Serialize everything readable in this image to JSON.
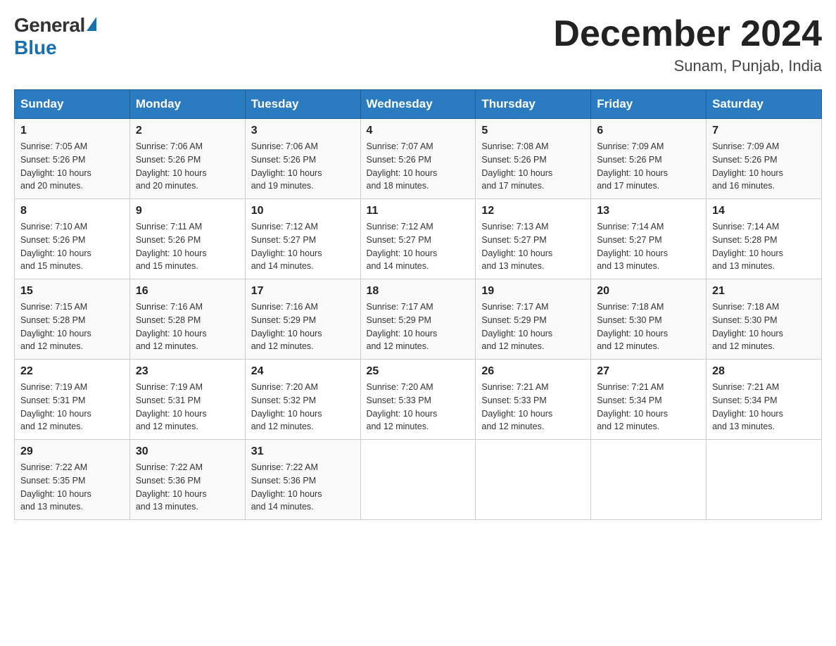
{
  "logo": {
    "general": "General",
    "blue": "Blue"
  },
  "title": "December 2024",
  "location": "Sunam, Punjab, India",
  "days_of_week": [
    "Sunday",
    "Monday",
    "Tuesday",
    "Wednesday",
    "Thursday",
    "Friday",
    "Saturday"
  ],
  "weeks": [
    [
      {
        "day": "1",
        "sunrise": "7:05 AM",
        "sunset": "5:26 PM",
        "daylight": "10 hours and 20 minutes."
      },
      {
        "day": "2",
        "sunrise": "7:06 AM",
        "sunset": "5:26 PM",
        "daylight": "10 hours and 20 minutes."
      },
      {
        "day": "3",
        "sunrise": "7:06 AM",
        "sunset": "5:26 PM",
        "daylight": "10 hours and 19 minutes."
      },
      {
        "day": "4",
        "sunrise": "7:07 AM",
        "sunset": "5:26 PM",
        "daylight": "10 hours and 18 minutes."
      },
      {
        "day": "5",
        "sunrise": "7:08 AM",
        "sunset": "5:26 PM",
        "daylight": "10 hours and 17 minutes."
      },
      {
        "day": "6",
        "sunrise": "7:09 AM",
        "sunset": "5:26 PM",
        "daylight": "10 hours and 17 minutes."
      },
      {
        "day": "7",
        "sunrise": "7:09 AM",
        "sunset": "5:26 PM",
        "daylight": "10 hours and 16 minutes."
      }
    ],
    [
      {
        "day": "8",
        "sunrise": "7:10 AM",
        "sunset": "5:26 PM",
        "daylight": "10 hours and 15 minutes."
      },
      {
        "day": "9",
        "sunrise": "7:11 AM",
        "sunset": "5:26 PM",
        "daylight": "10 hours and 15 minutes."
      },
      {
        "day": "10",
        "sunrise": "7:12 AM",
        "sunset": "5:27 PM",
        "daylight": "10 hours and 14 minutes."
      },
      {
        "day": "11",
        "sunrise": "7:12 AM",
        "sunset": "5:27 PM",
        "daylight": "10 hours and 14 minutes."
      },
      {
        "day": "12",
        "sunrise": "7:13 AM",
        "sunset": "5:27 PM",
        "daylight": "10 hours and 13 minutes."
      },
      {
        "day": "13",
        "sunrise": "7:14 AM",
        "sunset": "5:27 PM",
        "daylight": "10 hours and 13 minutes."
      },
      {
        "day": "14",
        "sunrise": "7:14 AM",
        "sunset": "5:28 PM",
        "daylight": "10 hours and 13 minutes."
      }
    ],
    [
      {
        "day": "15",
        "sunrise": "7:15 AM",
        "sunset": "5:28 PM",
        "daylight": "10 hours and 12 minutes."
      },
      {
        "day": "16",
        "sunrise": "7:16 AM",
        "sunset": "5:28 PM",
        "daylight": "10 hours and 12 minutes."
      },
      {
        "day": "17",
        "sunrise": "7:16 AM",
        "sunset": "5:29 PM",
        "daylight": "10 hours and 12 minutes."
      },
      {
        "day": "18",
        "sunrise": "7:17 AM",
        "sunset": "5:29 PM",
        "daylight": "10 hours and 12 minutes."
      },
      {
        "day": "19",
        "sunrise": "7:17 AM",
        "sunset": "5:29 PM",
        "daylight": "10 hours and 12 minutes."
      },
      {
        "day": "20",
        "sunrise": "7:18 AM",
        "sunset": "5:30 PM",
        "daylight": "10 hours and 12 minutes."
      },
      {
        "day": "21",
        "sunrise": "7:18 AM",
        "sunset": "5:30 PM",
        "daylight": "10 hours and 12 minutes."
      }
    ],
    [
      {
        "day": "22",
        "sunrise": "7:19 AM",
        "sunset": "5:31 PM",
        "daylight": "10 hours and 12 minutes."
      },
      {
        "day": "23",
        "sunrise": "7:19 AM",
        "sunset": "5:31 PM",
        "daylight": "10 hours and 12 minutes."
      },
      {
        "day": "24",
        "sunrise": "7:20 AM",
        "sunset": "5:32 PM",
        "daylight": "10 hours and 12 minutes."
      },
      {
        "day": "25",
        "sunrise": "7:20 AM",
        "sunset": "5:33 PM",
        "daylight": "10 hours and 12 minutes."
      },
      {
        "day": "26",
        "sunrise": "7:21 AM",
        "sunset": "5:33 PM",
        "daylight": "10 hours and 12 minutes."
      },
      {
        "day": "27",
        "sunrise": "7:21 AM",
        "sunset": "5:34 PM",
        "daylight": "10 hours and 12 minutes."
      },
      {
        "day": "28",
        "sunrise": "7:21 AM",
        "sunset": "5:34 PM",
        "daylight": "10 hours and 13 minutes."
      }
    ],
    [
      {
        "day": "29",
        "sunrise": "7:22 AM",
        "sunset": "5:35 PM",
        "daylight": "10 hours and 13 minutes."
      },
      {
        "day": "30",
        "sunrise": "7:22 AM",
        "sunset": "5:36 PM",
        "daylight": "10 hours and 13 minutes."
      },
      {
        "day": "31",
        "sunrise": "7:22 AM",
        "sunset": "5:36 PM",
        "daylight": "10 hours and 14 minutes."
      },
      null,
      null,
      null,
      null
    ]
  ],
  "labels": {
    "sunrise": "Sunrise:",
    "sunset": "Sunset:",
    "daylight": "Daylight:"
  }
}
